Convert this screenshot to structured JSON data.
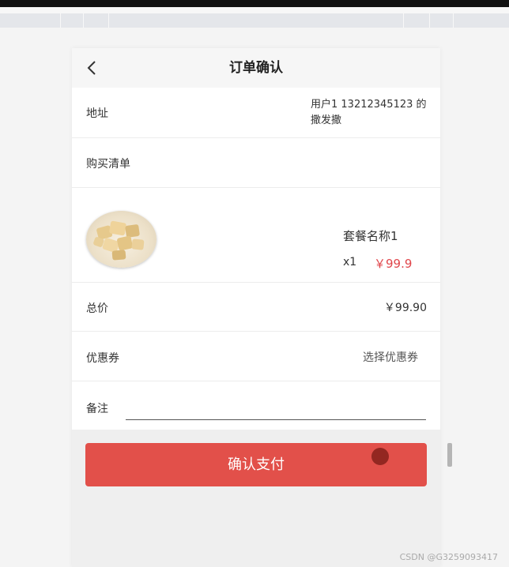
{
  "header": {
    "title": "订单确认",
    "back_icon": "chevron-left-icon"
  },
  "address": {
    "label": "地址",
    "value": "用户1 13212345123 的撒发撒"
  },
  "purchase_list": {
    "label": "购买清单"
  },
  "item": {
    "image_icon": "food-thumbnail",
    "name": "套餐名称1",
    "quantity": "x1",
    "price": "￥99.9"
  },
  "total": {
    "label": "总价",
    "value": "￥99.90"
  },
  "coupon": {
    "label": "优惠券",
    "action": "选择优惠券"
  },
  "note": {
    "label": "备注",
    "value": "",
    "placeholder": ""
  },
  "pay_button": {
    "label": "确认支付"
  },
  "watermark": "CSDN @G3259093417",
  "colors": {
    "accent": "#e2504a",
    "price": "#e0464b"
  }
}
